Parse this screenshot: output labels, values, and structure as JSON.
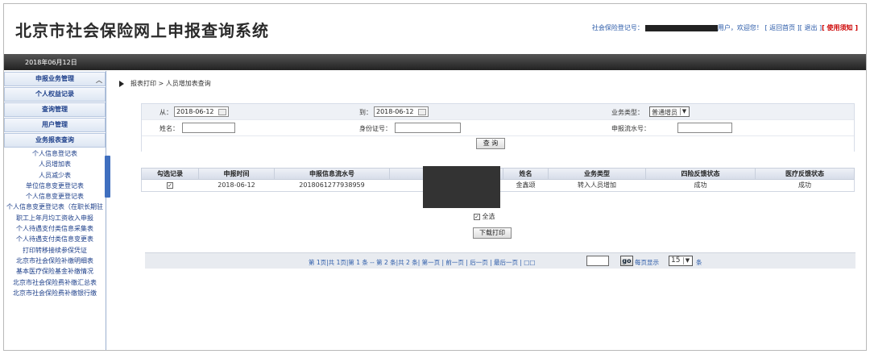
{
  "header": {
    "title": "北京市社会保险网上申报查询系统",
    "user_label": "社会保险登记号：",
    "welcome": "用户，欢迎您！",
    "links": [
      {
        "label": "[ 返回首页 ]"
      },
      {
        "label": "[ 退出 ]"
      },
      {
        "label": "[ 使用须知 ]"
      }
    ]
  },
  "date": "2018年06月12日",
  "sidebar": {
    "menus": [
      {
        "label": "申报业务管理"
      },
      {
        "label": "个人权益记录"
      },
      {
        "label": "查询管理"
      },
      {
        "label": "用户管理"
      },
      {
        "label": "业务报表查询"
      }
    ],
    "items": [
      {
        "label": "个人信息登记表"
      },
      {
        "label": "人员增加表"
      },
      {
        "label": "人员减少表"
      },
      {
        "label": "单位信息变更登记表"
      },
      {
        "label": "个人信息变更登记表"
      },
      {
        "label": "个人信息变更登记表（在职长期驻"
      },
      {
        "label": "职工上年月均工资收入申报"
      },
      {
        "label": "个人待遇支付类信息采集表"
      },
      {
        "label": "个人待遇支付类信息变更表"
      },
      {
        "label": "打印转移接续参保凭证"
      },
      {
        "label": "北京市社会保险补缴明细表"
      },
      {
        "label": "基本医疗保险基金补缴情况"
      },
      {
        "label": "北京市社会保险费补缴汇总表"
      },
      {
        "label": "北京市社会保险费补缴银行缴"
      }
    ]
  },
  "breadcrumb": "报表打印 > 人员增加表查询",
  "form": {
    "from_label": "从：",
    "from_value": "2018-06-12",
    "to_label": "到：",
    "to_value": "2018-06-12",
    "biz_type_label": "业务类型：",
    "biz_type_value": "普通增员",
    "name_label": "姓名：",
    "id_label": "身份证号：",
    "serial_label": "申报流水号：",
    "query_button": "查 询"
  },
  "table": {
    "headers": [
      "勾选记录",
      "申报时间",
      "申报信息流水号",
      "",
      "姓名",
      "业务类型",
      "四险反馈状态",
      "医疗反馈状态"
    ],
    "rows": [
      {
        "checked": "✓",
        "time": "2018-06-12",
        "serial": "2018061277938959",
        "name": "金鑫颂",
        "biz_type": "转入人员增加",
        "four_status": "成功",
        "medical_status": "成功"
      }
    ]
  },
  "select_all_label": "全选",
  "download_button": "下载打印",
  "pager": {
    "text": "第 1页|共 1页|第 1 条 -- 第 2 条|共 2 条| 第一页 | 前一页 | 后一页 | 最后一页 | □□",
    "go": "go",
    "page_size_label": "每页显示",
    "page_size": "15",
    "unit": "条"
  }
}
